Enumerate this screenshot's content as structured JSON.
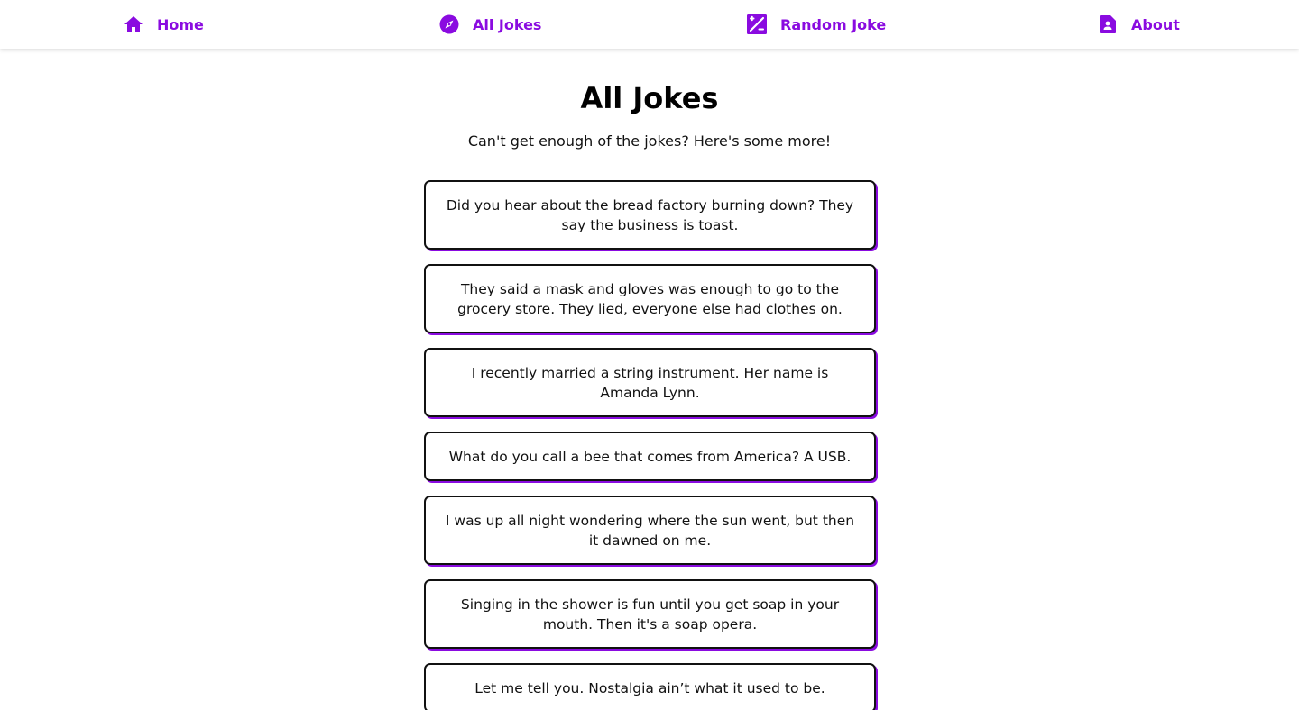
{
  "colors": {
    "accent": "#8a0be0",
    "text": "#111111",
    "background": "#ffffff"
  },
  "nav": {
    "items": [
      {
        "label": "Home",
        "icon": "home-icon"
      },
      {
        "label": "All Jokes",
        "icon": "compass-icon"
      },
      {
        "label": "Random Joke",
        "icon": "shuffle-icon"
      },
      {
        "label": "About",
        "icon": "contact-page-icon"
      }
    ]
  },
  "main": {
    "title": "All Jokes",
    "subtitle": "Can't get enough of the jokes? Here's some more!",
    "jokes": [
      "Did you hear about the bread factory burning down? They say the business is toast.",
      "They said a mask and gloves was enough to go to the grocery store. They lied, everyone else had clothes on.",
      "I recently married a string instrument. Her name is Amanda Lynn.",
      "What do you call a bee that comes from America? A USB.",
      "I was up all night wondering where the sun went, but then it dawned on me.",
      "Singing in the shower is fun until you get soap in your mouth. Then it's a soap opera.",
      "Let me tell you. Nostalgia ain’t what it used to be."
    ]
  }
}
